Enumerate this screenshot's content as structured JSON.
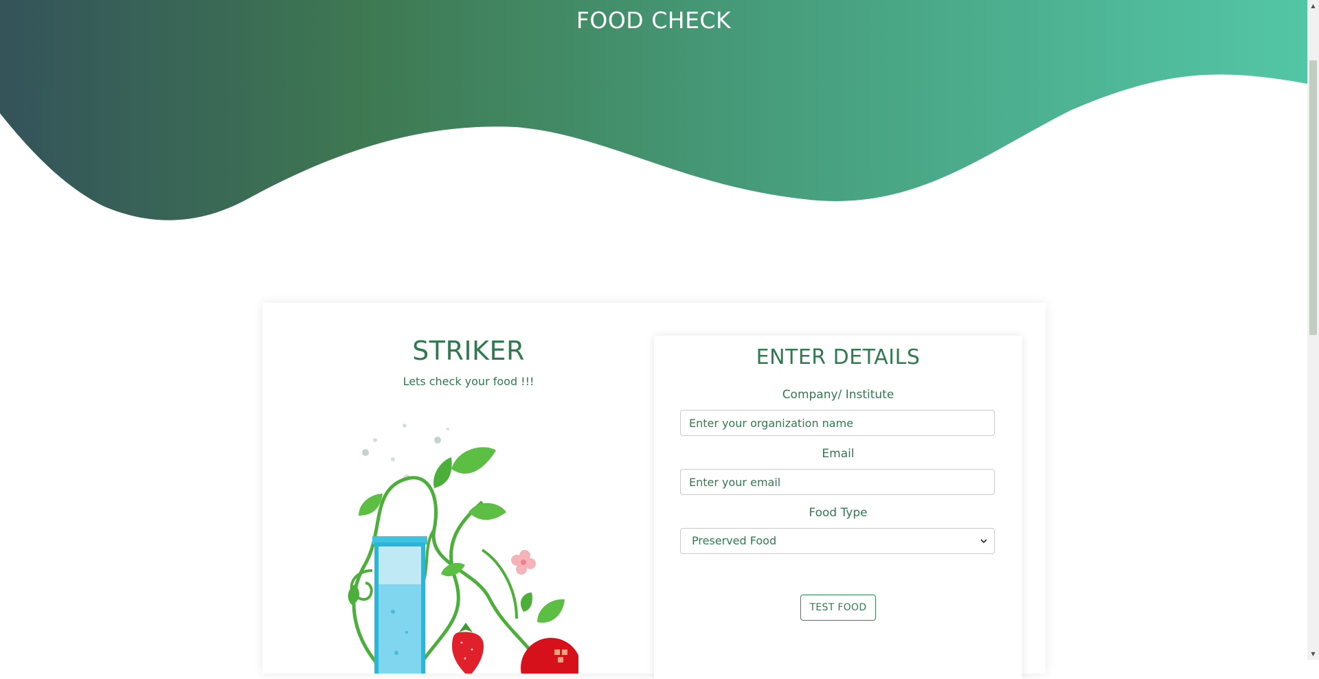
{
  "header": {
    "title": "FOOD CHECK"
  },
  "brand": {
    "title": "STRIKER",
    "tagline": "Lets check your food !!!"
  },
  "form": {
    "title": "ENTER DETAILS",
    "company_label": "Company/ Institute",
    "company_placeholder": "Enter your organization name",
    "email_label": "Email",
    "email_placeholder": "Enter your email",
    "food_type_label": "Food Type",
    "food_type_selected": "Preserved Food",
    "submit_label": "TEST FOOD"
  },
  "colors": {
    "accent": "#2f7a4f",
    "hero_gradient_start": "#34535a",
    "hero_gradient_mid": "#3f7a52",
    "hero_gradient_end": "#52c4a4"
  },
  "icons": {
    "select": "chevron-down-icon"
  }
}
